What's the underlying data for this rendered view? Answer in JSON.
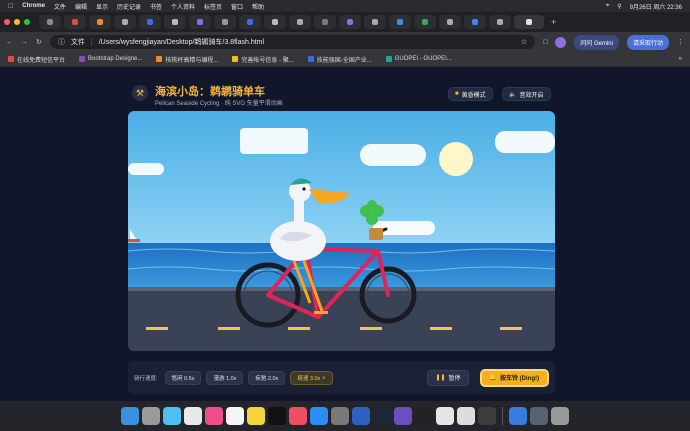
{
  "menubar": {
    "apple": "",
    "items": [
      "Chrome",
      "文件",
      "编辑",
      "显示",
      "历史记录",
      "书签",
      "个人资料",
      "标签页",
      "窗口",
      "帮助"
    ],
    "datetime": "9月26日 周六 22:36"
  },
  "toolbar": {
    "file_label": "文件",
    "url": "/Users/wysfengjiayan/Desktop/鹈鹕骑车/3.8flash.html",
    "gemini_label": "问问 Gemini",
    "restart_label": "请采取行动"
  },
  "bookmarks": [
    {
      "label": "在线免费短信平台",
      "color": "#e04b3c"
    },
    {
      "label": "Bootstrap Designe...",
      "color": "#7952b3"
    },
    {
      "label": "核桃杯高精与编程...",
      "color": "#f08a24"
    },
    {
      "label": "完善帐号信息 - 聚...",
      "color": "#f0c020"
    },
    {
      "label": "技能强国-全国产业...",
      "color": "#3d6ce0"
    },
    {
      "label": "GUOPEI - GUOPEI...",
      "color": "#2aa198"
    }
  ],
  "app": {
    "title": "海滨小岛：鹈鹕骑单车",
    "subtitle": "Pelican Seaside Cycling · 纯 SVG 矢量平滑动画",
    "theme_btn": "黄昏模式",
    "sound_btn": "音效开启",
    "speed_label": "骑行速度:",
    "speeds": [
      "悠闲 0.5x",
      "漫游 1.0x",
      "疾驰 2.0x",
      "极速 3.0x ⚡"
    ],
    "pause_btn": "暂停",
    "bell_btn": "按车铃 (Ding!)"
  },
  "colors": {
    "accent": "#f5b73b",
    "sky": "#5cb8ec",
    "sea": "#1a72c2",
    "road": "#3c4458",
    "bike_frame": "#e0245a"
  }
}
